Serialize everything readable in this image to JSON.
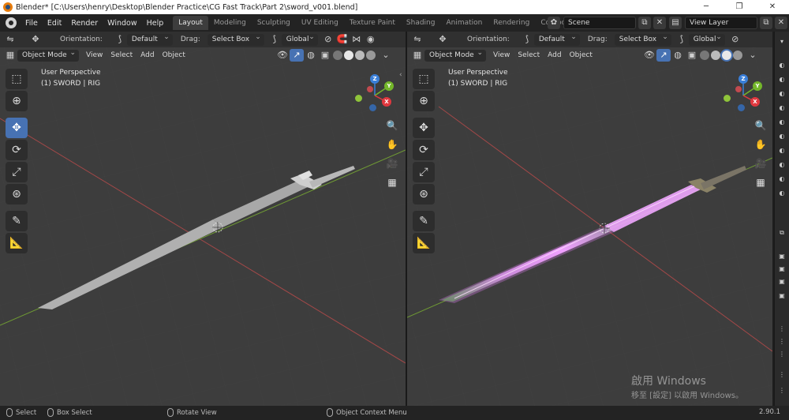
{
  "titlebar": {
    "title": "Blender* [C:\\Users\\henry\\Desktop\\Blender Practice\\CG Fast Track\\Part 2\\sword_v001.blend]",
    "minimize": "─",
    "maximize": "❐",
    "close": "✕"
  },
  "menubar": {
    "items": [
      "File",
      "Edit",
      "Render",
      "Window",
      "Help"
    ],
    "workspace_tabs": [
      "Layout",
      "Modeling",
      "Sculpting",
      "UV Editing",
      "Texture Paint",
      "Shading",
      "Animation",
      "Rendering",
      "Compos"
    ],
    "scene": "Scene",
    "view_layer": "View Layer"
  },
  "header": {
    "orientation_label": "Orientation:",
    "orientation_value": "Default",
    "drag_label": "Drag:",
    "drag_value": "Select Box",
    "transform_value": "Global",
    "mode": "Object Mode",
    "view": "View",
    "select": "Select",
    "add": "Add",
    "object": "Object"
  },
  "viewport": {
    "perspective": "User Perspective",
    "collection": "(1) SWORD | RIG",
    "axis_x": "X",
    "axis_y": "Y",
    "axis_z": "Z"
  },
  "watermark": {
    "line1": "啟用 Windows",
    "line2": "移至 [設定] 以啟用 Windows。"
  },
  "statusbar": {
    "select": "Select",
    "box_select": "Box Select",
    "rotate_view": "Rotate View",
    "context_menu": "Object Context Menu",
    "version": "2.90.1"
  },
  "colors": {
    "accent": "#4772b3",
    "axis_x": "#e0383f",
    "axis_y": "#74b72a",
    "axis_z": "#3a7fd8",
    "glow": "#e86bff"
  }
}
